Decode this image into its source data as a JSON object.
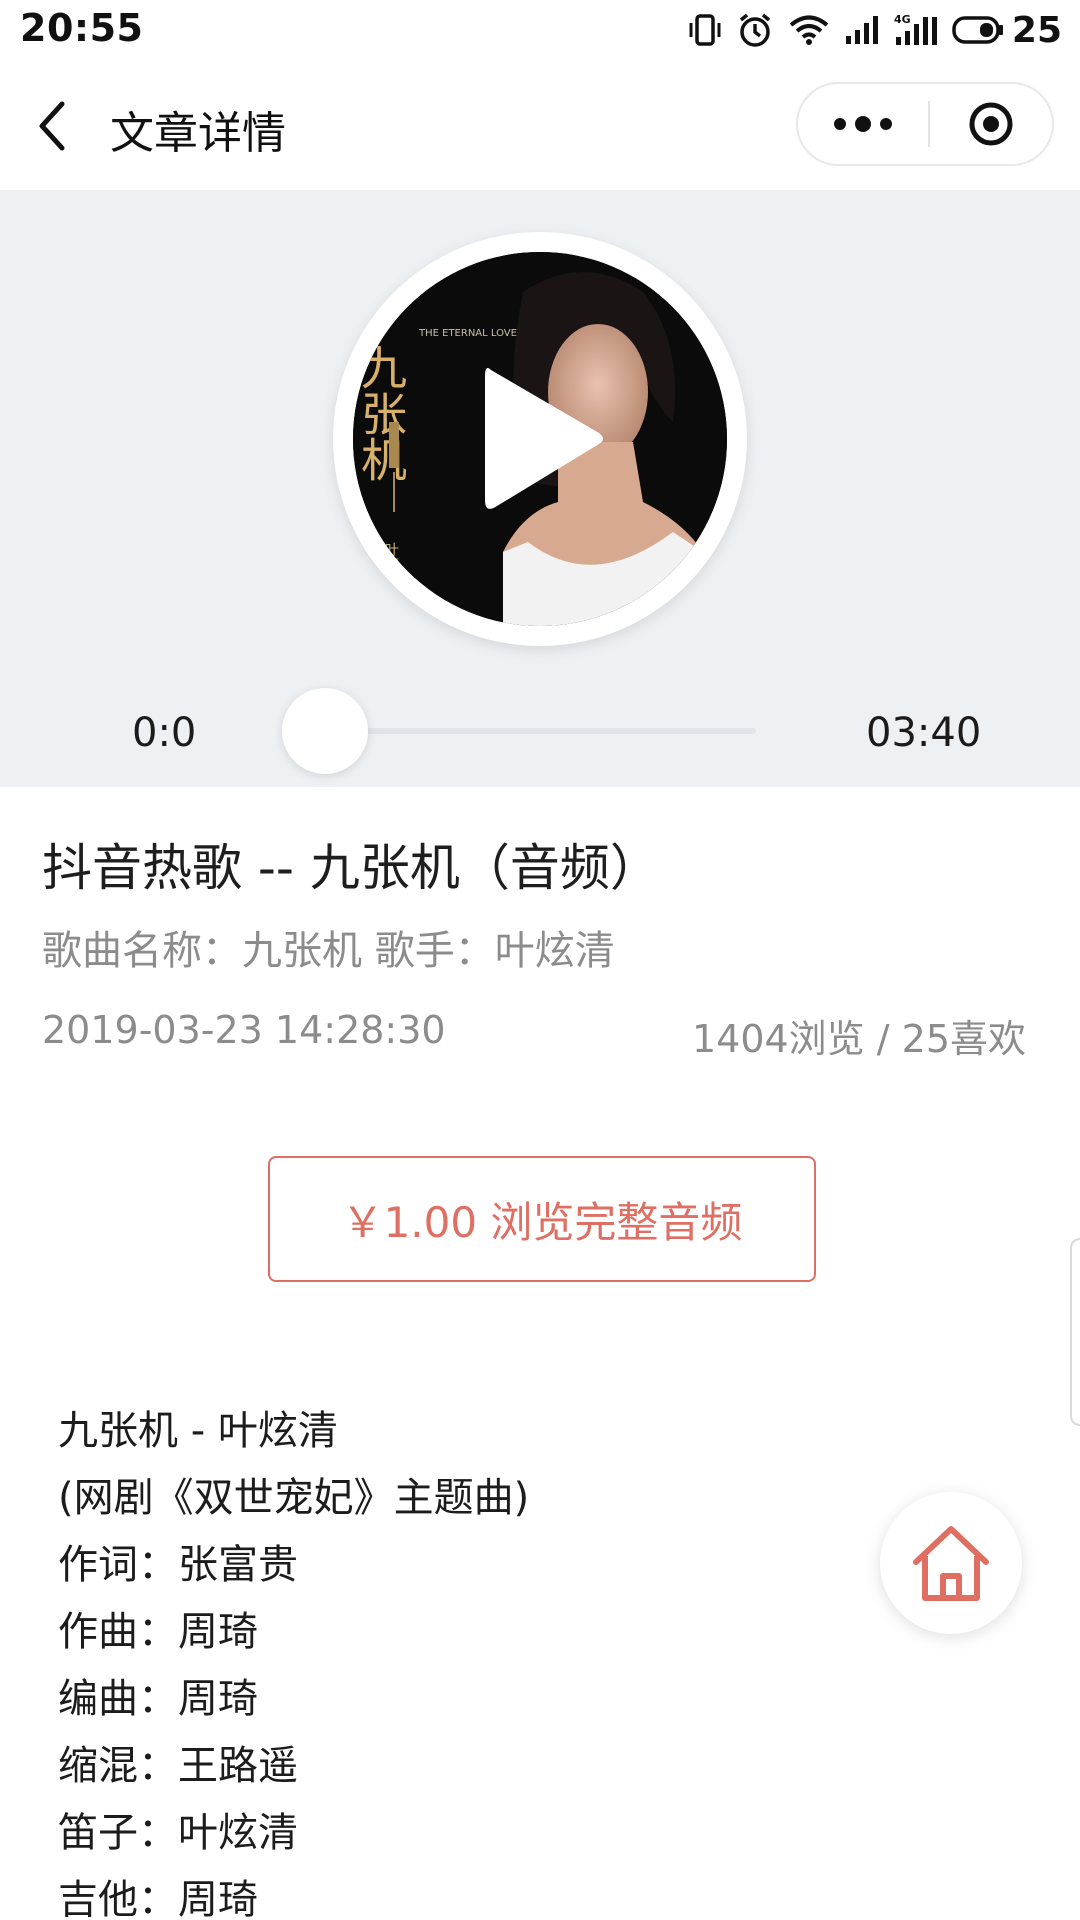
{
  "status_bar": {
    "time": "20:55",
    "battery": "25",
    "icons": [
      "vibrate-icon",
      "alarm-icon",
      "wifi-icon",
      "signal-icon",
      "signal-4g-icon",
      "battery-icon"
    ]
  },
  "nav": {
    "title": "文章详情",
    "back_icon": "chevron-left-icon",
    "more_icon": "more-dots-icon",
    "close_icon": "target-circle-icon"
  },
  "player": {
    "current_time": "0:0",
    "duration": "03:40",
    "progress": 0,
    "play_icon": "play-icon",
    "cover_text": "九张机",
    "cover_subtext": "THE ETERNAL LOVE",
    "cover_side": "叶炫清"
  },
  "article": {
    "title": "抖音热歌 -- 九张机（音频）",
    "subtitle": "歌曲名称：九张机 歌手：叶炫清",
    "date": "2019-03-23 14:28:30",
    "stats": "1404浏览 / 25喜欢"
  },
  "pay_button": {
    "label": "￥1.00 浏览完整音频"
  },
  "lyrics": [
    "九张机 - 叶炫清",
    "(网剧《双世宠妃》主题曲)",
    "作词：张富贵",
    "作曲：周琦",
    "编曲：周琦",
    "缩混：王路遥",
    "笛子：叶炫清",
    "吉他：周琦"
  ],
  "home_fab": {
    "icon": "home-icon"
  },
  "colors": {
    "accent": "#de6f62",
    "player_bg": "#edf1f4",
    "muted_text": "#8c8c8c"
  }
}
